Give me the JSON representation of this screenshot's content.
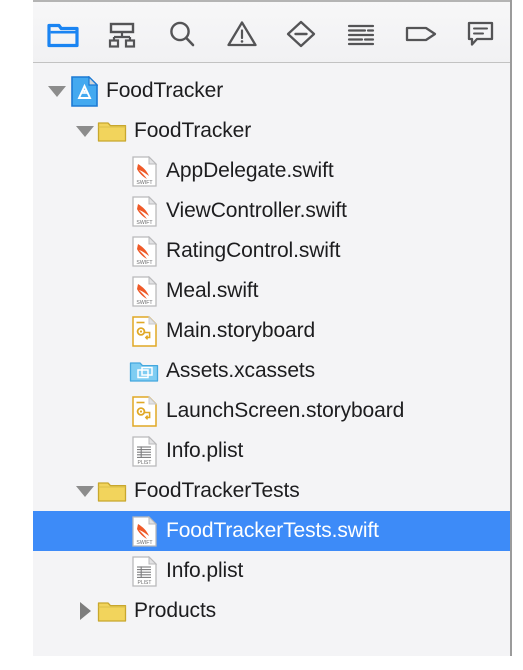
{
  "window": {
    "title": "Xcode Project Navigator"
  },
  "colors": {
    "selection_blue": "#3d8bf8",
    "accent_blue": "#2f7cf6",
    "folder_yellow": "#f2d45c",
    "assets_blue": "#7fcdf2",
    "swift_orange": "#f05a28",
    "storyboard_gold": "#e8a820",
    "panel_bg": "#f4f4f6",
    "text_primary": "#1d1d1f",
    "icon_gray": "#545456"
  },
  "toolbar": {
    "buttons": [
      {
        "name": "project-navigator-button",
        "icon": "folder-icon",
        "label": "Project navigator",
        "selected": true
      },
      {
        "name": "source-control-navigator-button",
        "icon": "hierarchy-icon",
        "label": "Source control navigator",
        "selected": false
      },
      {
        "name": "find-navigator-button",
        "icon": "search-icon",
        "label": "Find navigator",
        "selected": false
      },
      {
        "name": "issue-navigator-button",
        "icon": "warning-triangle-icon",
        "label": "Issue navigator",
        "selected": false
      },
      {
        "name": "test-navigator-button",
        "icon": "diamond-minus-icon",
        "label": "Test navigator",
        "selected": false
      },
      {
        "name": "debug-navigator-button",
        "icon": "report-lines-icon",
        "label": "Debug navigator",
        "selected": false
      },
      {
        "name": "breakpoint-navigator-button",
        "icon": "breakpoint-tag-icon",
        "label": "Breakpoint navigator",
        "selected": false
      },
      {
        "name": "report-navigator-button",
        "icon": "speech-bubble-icon",
        "label": "Report navigator",
        "selected": false
      }
    ]
  },
  "tree": {
    "rows": [
      {
        "name": "tree-item-foodtracker-project",
        "label": "FoodTracker",
        "icon": "xcode-project-icon",
        "twisty": "open",
        "indent": 0,
        "selected": false
      },
      {
        "name": "tree-item-foodtracker-group",
        "label": "FoodTracker",
        "icon": "folder-icon",
        "twisty": "open",
        "indent": 1,
        "selected": false
      },
      {
        "name": "tree-item-appdelegate-swift",
        "label": "AppDelegate.swift",
        "icon": "swift-file-icon",
        "twisty": "none",
        "indent": 2,
        "selected": false
      },
      {
        "name": "tree-item-viewcontroller-swift",
        "label": "ViewController.swift",
        "icon": "swift-file-icon",
        "twisty": "none",
        "indent": 2,
        "selected": false
      },
      {
        "name": "tree-item-ratingcontrol-swift",
        "label": "RatingControl.swift",
        "icon": "swift-file-icon",
        "twisty": "none",
        "indent": 2,
        "selected": false
      },
      {
        "name": "tree-item-meal-swift",
        "label": "Meal.swift",
        "icon": "swift-file-icon",
        "twisty": "none",
        "indent": 2,
        "selected": false
      },
      {
        "name": "tree-item-main-storyboard",
        "label": "Main.storyboard",
        "icon": "storyboard-icon",
        "twisty": "none",
        "indent": 2,
        "selected": false
      },
      {
        "name": "tree-item-assets-xcassets",
        "label": "Assets.xcassets",
        "icon": "assets-folder-icon",
        "twisty": "none",
        "indent": 2,
        "selected": false
      },
      {
        "name": "tree-item-launchscreen-storyboard",
        "label": "LaunchScreen.storyboard",
        "icon": "storyboard-icon",
        "twisty": "none",
        "indent": 2,
        "selected": false
      },
      {
        "name": "tree-item-info-plist",
        "label": "Info.plist",
        "icon": "plist-icon",
        "twisty": "none",
        "indent": 2,
        "selected": false
      },
      {
        "name": "tree-item-foodtrackertests-group",
        "label": "FoodTrackerTests",
        "icon": "folder-icon",
        "twisty": "open",
        "indent": 1,
        "selected": false
      },
      {
        "name": "tree-item-foodtrackertests-swift",
        "label": "FoodTrackerTests.swift",
        "icon": "swift-file-icon",
        "twisty": "none",
        "indent": 2,
        "selected": true
      },
      {
        "name": "tree-item-tests-info-plist",
        "label": "Info.plist",
        "icon": "plist-icon",
        "twisty": "none",
        "indent": 2,
        "selected": false
      },
      {
        "name": "tree-item-products-group",
        "label": "Products",
        "icon": "folder-icon",
        "twisty": "closed",
        "indent": 1,
        "selected": false
      }
    ]
  }
}
